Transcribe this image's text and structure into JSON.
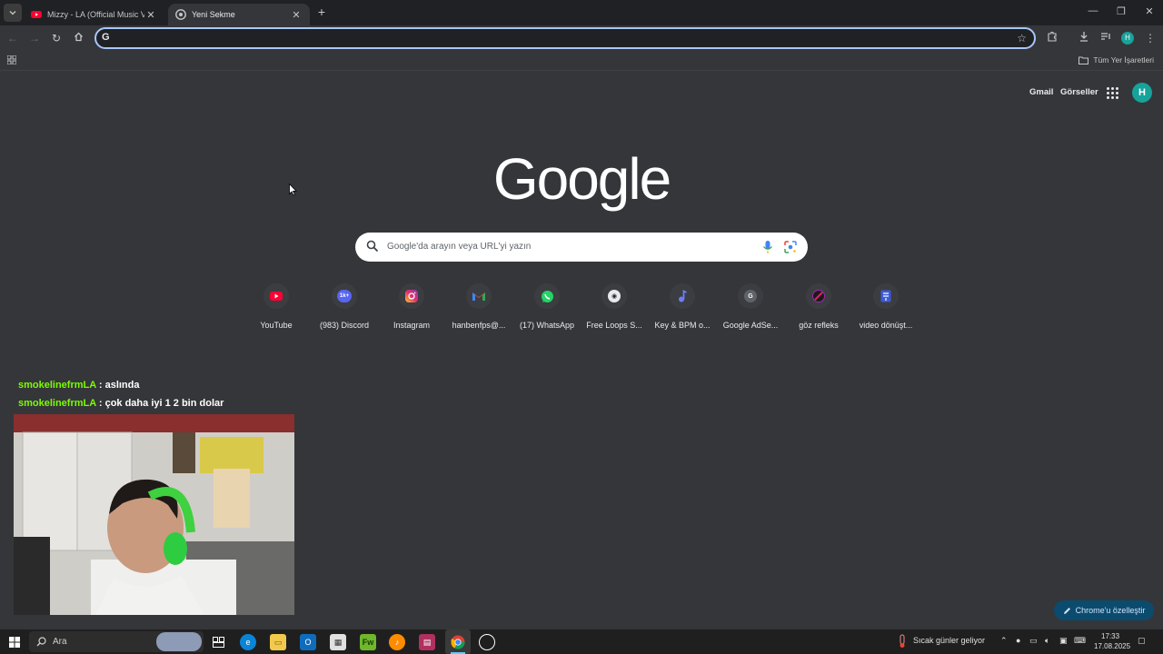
{
  "tabs": [
    {
      "title": "Mizzy - LA (Official Music Video)",
      "icon": "youtube-icon",
      "active": false
    },
    {
      "title": "Yeni Sekme",
      "icon": "chrome-icon",
      "active": true
    }
  ],
  "omnibox": {
    "value": "",
    "placeholder": ""
  },
  "profile": {
    "initial": "H",
    "color": "#16a39a"
  },
  "bookmarks": {
    "all_bookmarks_label": "Tüm Yer İşaretleri"
  },
  "ntp": {
    "header_links": {
      "gmail": "Gmail",
      "images": "Görseller"
    },
    "logo_text": "Google",
    "search_placeholder": "Google'da arayın veya URL'yi yazın",
    "shortcuts": [
      {
        "name": "YouTube",
        "icon": "youtube-icon"
      },
      {
        "name": "(983) Discord",
        "icon": "discord-icon",
        "badge": "1k+"
      },
      {
        "name": "Instagram",
        "icon": "instagram-icon"
      },
      {
        "name": "hanbenfps@...",
        "icon": "gmail-icon"
      },
      {
        "name": "(17) WhatsApp",
        "icon": "whatsapp-icon"
      },
      {
        "name": "Free Loops S...",
        "icon": "free-loops-icon"
      },
      {
        "name": "Key & BPM o...",
        "icon": "key-bpm-icon"
      },
      {
        "name": "Google AdSe...",
        "icon": "adsense-icon",
        "letter": "G"
      },
      {
        "name": "göz refleks",
        "icon": "reflex-icon"
      },
      {
        "name": "video dönüşt...",
        "icon": "video-convert-icon"
      }
    ],
    "customize_label": "Chrome'u özelleştir"
  },
  "chat": [
    {
      "user": "smokelinefrmLA",
      "sep": " : ",
      "message": "aslında"
    },
    {
      "user": "smokelinefrmLA",
      "sep": " : ",
      "message": "çok daha iyi 1 2 bin dolar"
    }
  ],
  "taskbar": {
    "search_label": "Ara",
    "weather": "Sıcak günler geliyor",
    "time": "17:33",
    "date": "17.08.2025"
  },
  "colors": {
    "accent": "#a8c7fa",
    "chat_user": "#7cfc00",
    "background": "#35363a"
  }
}
